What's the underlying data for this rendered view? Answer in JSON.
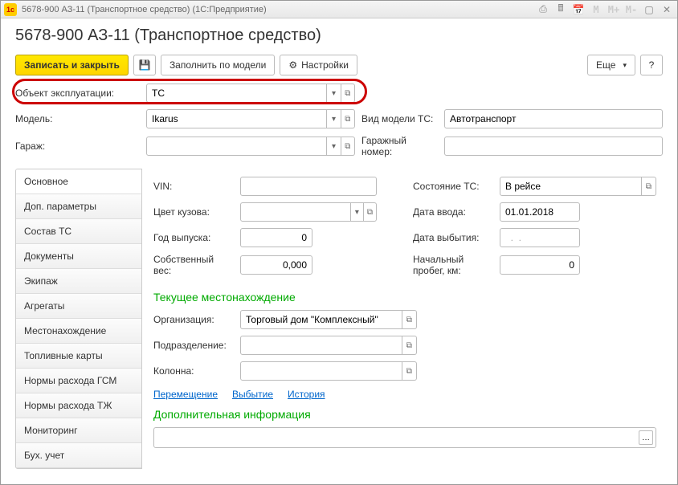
{
  "titlebar": {
    "text": "5678-900 АЗ-11 (Транспортное средство)  (1С:Предприятие)"
  },
  "header": {
    "title": "5678-900 АЗ-11 (Транспортное средство)"
  },
  "toolbar": {
    "save_close": "Записать и закрыть",
    "fill_by_model": "Заполнить по модели",
    "settings": "Настройки",
    "more": "Еще",
    "help": "?"
  },
  "top_form": {
    "object_label": "Объект эксплуатации:",
    "object_value": "ТС",
    "model_label": "Модель:",
    "model_value": "Ikarus",
    "ts_type_label": "Вид модели ТС:",
    "ts_type_value": "Автотранспорт",
    "garage_label": "Гараж:",
    "garage_value": "",
    "garage_num_label": "Гаражный номер:",
    "garage_num_value": ""
  },
  "tabs": [
    "Основное",
    "Доп. параметры",
    "Состав ТС",
    "Документы",
    "Экипаж",
    "Агрегаты",
    "Местонахождение",
    "Топливные карты",
    "Нормы расхода ГСМ",
    "Нормы расхода ТЖ",
    "Мониторинг",
    "Бух. учет"
  ],
  "main": {
    "vin_label": "VIN:",
    "vin_value": "",
    "color_label": "Цвет кузова:",
    "color_value": "",
    "year_label": "Год выпуска:",
    "year_value": "0",
    "weight_label": "Собственный вес:",
    "weight_value": "0,000",
    "state_label": "Состояние ТС:",
    "state_value": "В рейсе",
    "date_in_label": "Дата ввода:",
    "date_in_value": "01.01.2018",
    "date_out_label": "Дата выбытия:",
    "date_out_value": "  .  .",
    "mileage_label": "Начальный пробег, км:",
    "mileage_value": "0",
    "location_title": "Текущее местонахождение",
    "org_label": "Организация:",
    "org_value": "Торговый дом \"Комплексный\"",
    "dept_label": "Подразделение:",
    "dept_value": "",
    "column_label": "Колонна:",
    "column_value": "",
    "link_move": "Перемещение",
    "link_out": "Выбытие",
    "link_hist": "История",
    "extra_title": "Дополнительная информация",
    "extra_value": ""
  }
}
